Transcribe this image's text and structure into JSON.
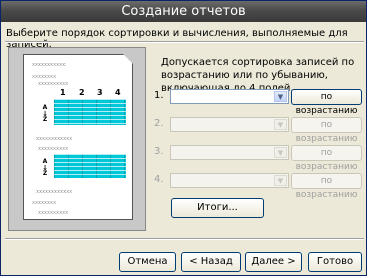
{
  "window": {
    "title": "Создание отчетов"
  },
  "instruction": "Выберите порядок сортировки и вычисления, выполняемые для записей.",
  "preview": {
    "filler": "xxxxxxxxxxxxxxx",
    "column_numbers": [
      "1",
      "2",
      "3",
      "4"
    ],
    "sort_glyph_top": "A",
    "sort_glyph_bottom": "Z"
  },
  "info_text": "Допускается сортировка записей по возрастанию или по убыванию, включающая до 4 полей.",
  "sort_rows": [
    {
      "label": "1.",
      "value": "",
      "button": "по возрастанию",
      "enabled": true
    },
    {
      "label": "2.",
      "value": "",
      "button": "по возрастанию",
      "enabled": false
    },
    {
      "label": "3.",
      "value": "",
      "button": "по возрастанию",
      "enabled": false
    },
    {
      "label": "4.",
      "value": "",
      "button": "по возрастанию",
      "enabled": false
    }
  ],
  "buttons": {
    "totals": "Итоги...",
    "cancel": "Отмена",
    "back": "< Назад",
    "next": "Далее >",
    "finish": "Готово"
  },
  "colors": {
    "title_bar": "#4a4a4a",
    "preview_highlight": "#00c8d8",
    "dialog_background": "#ece9d8"
  }
}
